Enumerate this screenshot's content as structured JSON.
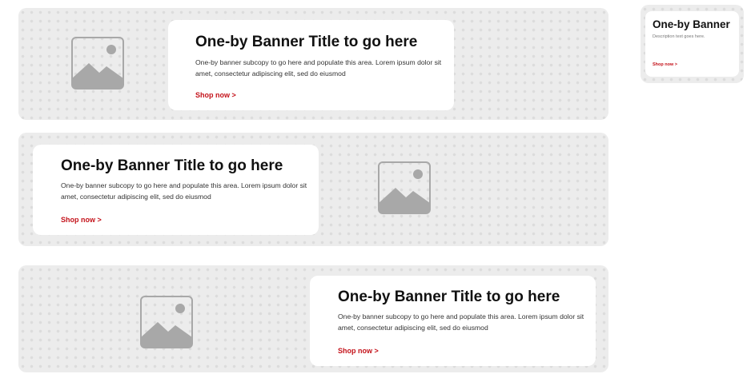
{
  "colors": {
    "banner_bg": "#ececec",
    "card_bg": "#ffffff",
    "title": "#111111",
    "cta": "#c4121a",
    "placeholder_icon": "#a8a8a8"
  },
  "banners": [
    {
      "title": "One-by Banner Title to go here",
      "subcopy": "One-by banner subcopy to go here and populate this area. Lorem ipsum dolor sit amet, consectetur adipiscing elit, sed do eiusmod",
      "cta": "Shop now >",
      "image_icon": "image-placeholder-icon"
    },
    {
      "title": "One-by Banner Title to go here",
      "subcopy": "One-by banner subcopy to go here and populate this area. Lorem ipsum dolor sit amet, consectetur adipiscing elit, sed do eiusmod",
      "cta": "Shop now >",
      "image_icon": "image-placeholder-icon"
    },
    {
      "title": "One-by Banner Title to go here",
      "subcopy": "One-by banner subcopy to go here and populate this area. Lorem ipsum dolor sit amet, consectetur adipiscing elit, sed do eiusmod",
      "cta": "Shop now >",
      "image_icon": "image-placeholder-icon"
    }
  ],
  "small_banner": {
    "title": "One-by Banner",
    "description": "Description text goes here.",
    "cta": "Shop now >"
  }
}
